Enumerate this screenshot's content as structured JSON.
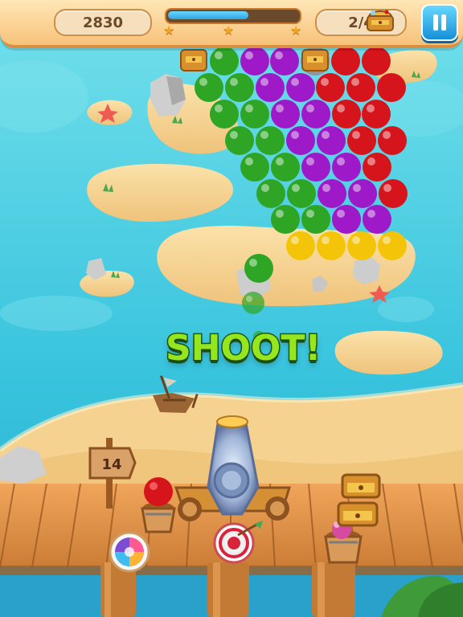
{
  "hud": {
    "score": "2830",
    "progress": 0.62,
    "stars_reached": 1,
    "chests": "2/4",
    "pause_icon": "pause-icon",
    "chest_icon": "treasure-chest-icon"
  },
  "game": {
    "banner": "SHOOT!",
    "shots_left": "14",
    "current_ball": "green",
    "next_ball": "red",
    "booster_icons": [
      "rainbow-ball-icon",
      "target-icon",
      "color-bucket-icon"
    ]
  },
  "colors": {
    "green": "#2ea524",
    "purple": "#9e19c8",
    "red": "#d6141b",
    "yellow": "#f4c409",
    "water": "#4fd0e6",
    "sand": "#f4d08f",
    "wood": "#d88b3a"
  }
}
